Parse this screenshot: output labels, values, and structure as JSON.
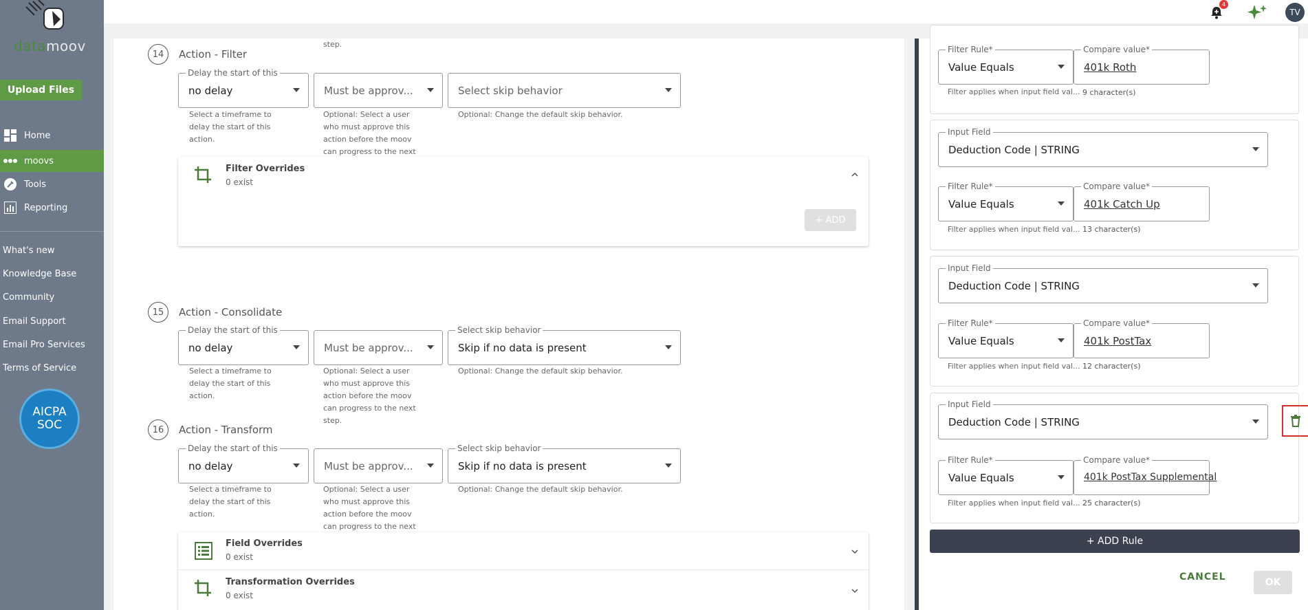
{
  "sidebar": {
    "logo": {
      "part1": "data",
      "part2": "moov"
    },
    "upload_label": "Upload Files",
    "nav": [
      {
        "label": "Home",
        "icon": "dashboard-icon"
      },
      {
        "label": "moovs",
        "icon": "dots-icon",
        "active": true
      },
      {
        "label": "Tools",
        "icon": "wrench-icon"
      },
      {
        "label": "Reporting",
        "icon": "bar-chart-icon"
      }
    ],
    "links": [
      "What's new",
      "Knowledge Base",
      "Community",
      "Email Support",
      "Email Pro Services",
      "Terms of Service"
    ],
    "badge": {
      "l1": "AICPA",
      "l2": "SOC"
    }
  },
  "topbar": {
    "notification_count": "4",
    "avatar_initials": "TV"
  },
  "steps": {
    "s14": {
      "number": "14",
      "title": "Action - Filter",
      "delay_legend": "Delay the start of this",
      "delay_value": "no delay",
      "delay_help": [
        "Select a timeframe to",
        "delay the start of this",
        "action."
      ],
      "approve_placeholder": "Must be approv...",
      "approve_help": [
        "Optional: Select a user",
        "who must approve this",
        "action before the moov",
        "can progress to the next"
      ],
      "approve_help_top": "step.",
      "skip_placeholder": "Select skip behavior",
      "skip_help": "Optional: Change the default skip behavior.",
      "card": {
        "title": "Filter Overrides",
        "sub": "0 exist",
        "add": "+ ADD"
      }
    },
    "s15": {
      "number": "15",
      "title": "Action - Consolidate",
      "delay_legend": "Delay the start of this",
      "delay_value": "no delay",
      "delay_help": [
        "Select a timeframe to",
        "delay the start of this",
        "action."
      ],
      "approve_placeholder": "Must be approv...",
      "approve_help": [
        "Optional: Select a user",
        "who must approve this",
        "action before the moov",
        "can progress to the next",
        "step."
      ],
      "skip_legend": "Select skip behavior",
      "skip_value": "Skip if no data is present",
      "skip_help": "Optional: Change the default skip behavior."
    },
    "s16": {
      "number": "16",
      "title": "Action - Transform",
      "delay_legend": "Delay the start of this",
      "delay_value": "no delay",
      "delay_help": [
        "Select a timeframe to",
        "delay the start of this",
        "action."
      ],
      "approve_placeholder": "Must be approv...",
      "approve_help": [
        "Optional: Select a user",
        "who must approve this",
        "action before the moov",
        "can progress to the next"
      ],
      "skip_legend": "Select skip behavior",
      "skip_value": "Skip if no data is present",
      "skip_help": "Optional: Change the default skip behavior.",
      "field_card": {
        "title": "Field Overrides",
        "sub": "0 exist"
      },
      "transform_card": {
        "title": "Transformation Overrides",
        "sub": "0 exist"
      }
    }
  },
  "rules_panel": {
    "labels": {
      "input_field": "Input Field",
      "filter_rule": "Filter Rule*",
      "compare_value": "Compare value*",
      "filter_help": "Filter applies when input field val..."
    },
    "rules": [
      {
        "input": "",
        "filter": "Value Equals",
        "compare": "401k Roth",
        "count": "9 character(s)"
      },
      {
        "input": "Deduction Code | STRING",
        "filter": "Value Equals",
        "compare": "401k Catch Up",
        "count": "13 character(s)"
      },
      {
        "input": "Deduction Code | STRING",
        "filter": "Value Equals",
        "compare": "401k PostTax",
        "count": "12 character(s)"
      },
      {
        "input": "Deduction Code | STRING",
        "filter": "Value Equals",
        "compare": "401k PostTax Supplemental",
        "count": "25 character(s)"
      }
    ],
    "add_rule": "+ ADD Rule",
    "cancel": "CANCEL",
    "ok": "OK"
  }
}
